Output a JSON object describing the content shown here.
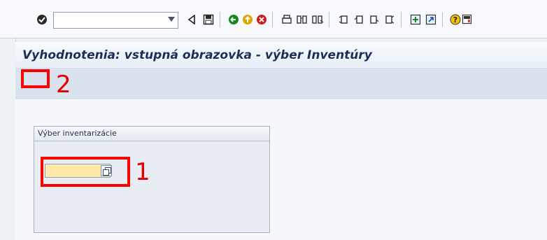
{
  "title": "Vyhodnotenia: vstupná obrazovka - výber Inventúry",
  "group_title": "Výber inventarizácie",
  "field_value": "",
  "annotations": [
    "1",
    "2"
  ],
  "colors": {
    "title_text": "#1b2f57",
    "field_bg": "#ffe8a8",
    "annotation_red": "#ff0000"
  },
  "toolbar_icons": [
    "check-icon",
    "back-icon",
    "save-icon",
    "nav-back-icon",
    "exit-icon",
    "cancel-icon",
    "print-icon",
    "find-icon",
    "find-next-icon",
    "first-page-icon",
    "prev-page-icon",
    "next-page-icon",
    "last-page-icon",
    "new-session-icon",
    "shortcut-icon",
    "help-icon",
    "layout-icon"
  ]
}
